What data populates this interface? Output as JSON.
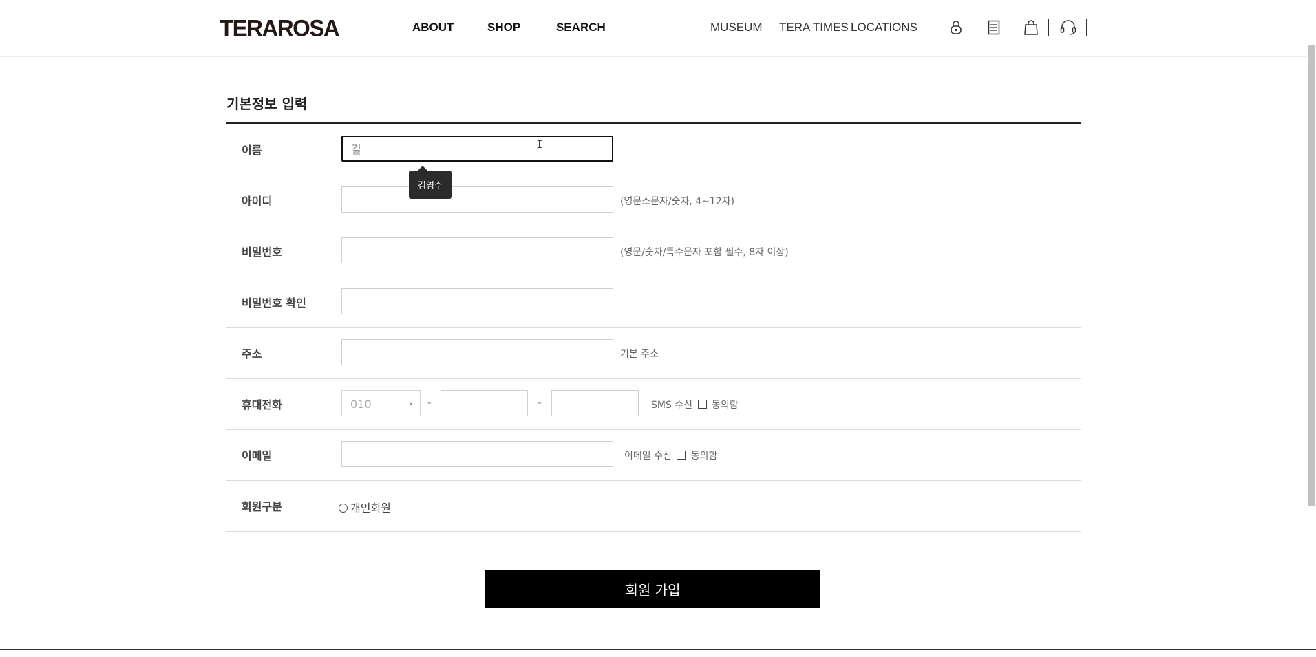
{
  "header": {
    "logo": "TERAROSA",
    "nav_main": [
      "ABOUT",
      "SHOP",
      "SEARCH"
    ],
    "nav_sub": [
      "MUSEUM",
      "TERA TIMES",
      "LOCATIONS"
    ],
    "icons": [
      "lock-icon",
      "receipt-icon",
      "shopping-bag-icon",
      "headset-icon"
    ]
  },
  "form": {
    "title": "기본정보 입력",
    "name": {
      "label": "이름",
      "value": "길"
    },
    "autocomplete_tooltip": "김영수",
    "id": {
      "label": "아이디",
      "hint": "(영문소문자/숫자, 4~12자)"
    },
    "password": {
      "label": "비밀번호",
      "hint": "(영문/숫자/특수문자 포함 필수, 8자 이상)"
    },
    "password_confirm": {
      "label": "비밀번호 확인"
    },
    "address": {
      "label": "주소",
      "hint": "기본 주소"
    },
    "phone": {
      "label": "휴대전화",
      "prefix": "010",
      "dash": "-",
      "sms_label": "SMS 수신",
      "agree": "동의함"
    },
    "email": {
      "label": "이메일",
      "consent_label": "이메일 수신",
      "agree": "동의함"
    },
    "member_type": {
      "label": "회원구분",
      "option": "개인회원"
    },
    "submit": "회원 가입"
  }
}
